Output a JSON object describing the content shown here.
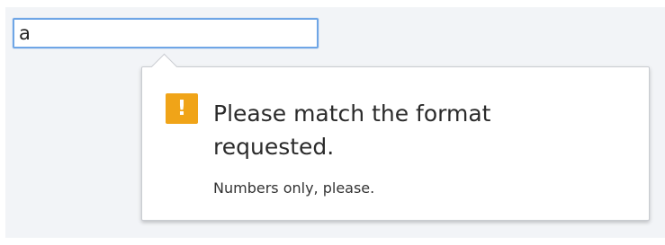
{
  "input": {
    "value": "a"
  },
  "validation_tooltip": {
    "icon": "warning-icon",
    "icon_glyph": "!",
    "icon_color": "#f0a418",
    "message": "Please match the format requested.",
    "hint": "Numbers only, please."
  },
  "colors": {
    "input_focus_border": "#6fa6e6",
    "background": "#f2f4f7"
  }
}
